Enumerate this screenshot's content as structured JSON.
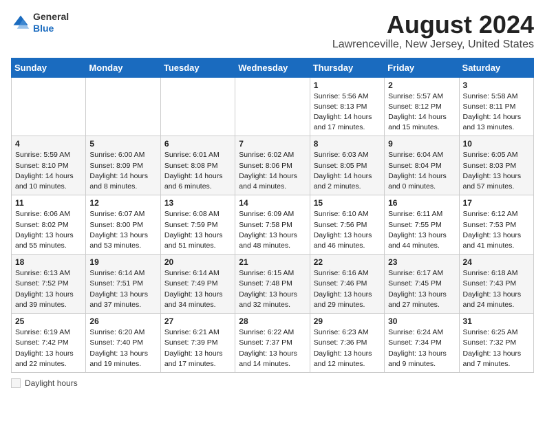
{
  "header": {
    "logo_general": "General",
    "logo_blue": "Blue",
    "main_title": "August 2024",
    "subtitle": "Lawrenceville, New Jersey, United States"
  },
  "weekdays": [
    "Sunday",
    "Monday",
    "Tuesday",
    "Wednesday",
    "Thursday",
    "Friday",
    "Saturday"
  ],
  "weeks": [
    [
      {
        "day": "",
        "info": ""
      },
      {
        "day": "",
        "info": ""
      },
      {
        "day": "",
        "info": ""
      },
      {
        "day": "",
        "info": ""
      },
      {
        "day": "1",
        "info": "Sunrise: 5:56 AM\nSunset: 8:13 PM\nDaylight: 14 hours and 17 minutes."
      },
      {
        "day": "2",
        "info": "Sunrise: 5:57 AM\nSunset: 8:12 PM\nDaylight: 14 hours and 15 minutes."
      },
      {
        "day": "3",
        "info": "Sunrise: 5:58 AM\nSunset: 8:11 PM\nDaylight: 14 hours and 13 minutes."
      }
    ],
    [
      {
        "day": "4",
        "info": "Sunrise: 5:59 AM\nSunset: 8:10 PM\nDaylight: 14 hours and 10 minutes."
      },
      {
        "day": "5",
        "info": "Sunrise: 6:00 AM\nSunset: 8:09 PM\nDaylight: 14 hours and 8 minutes."
      },
      {
        "day": "6",
        "info": "Sunrise: 6:01 AM\nSunset: 8:08 PM\nDaylight: 14 hours and 6 minutes."
      },
      {
        "day": "7",
        "info": "Sunrise: 6:02 AM\nSunset: 8:06 PM\nDaylight: 14 hours and 4 minutes."
      },
      {
        "day": "8",
        "info": "Sunrise: 6:03 AM\nSunset: 8:05 PM\nDaylight: 14 hours and 2 minutes."
      },
      {
        "day": "9",
        "info": "Sunrise: 6:04 AM\nSunset: 8:04 PM\nDaylight: 14 hours and 0 minutes."
      },
      {
        "day": "10",
        "info": "Sunrise: 6:05 AM\nSunset: 8:03 PM\nDaylight: 13 hours and 57 minutes."
      }
    ],
    [
      {
        "day": "11",
        "info": "Sunrise: 6:06 AM\nSunset: 8:02 PM\nDaylight: 13 hours and 55 minutes."
      },
      {
        "day": "12",
        "info": "Sunrise: 6:07 AM\nSunset: 8:00 PM\nDaylight: 13 hours and 53 minutes."
      },
      {
        "day": "13",
        "info": "Sunrise: 6:08 AM\nSunset: 7:59 PM\nDaylight: 13 hours and 51 minutes."
      },
      {
        "day": "14",
        "info": "Sunrise: 6:09 AM\nSunset: 7:58 PM\nDaylight: 13 hours and 48 minutes."
      },
      {
        "day": "15",
        "info": "Sunrise: 6:10 AM\nSunset: 7:56 PM\nDaylight: 13 hours and 46 minutes."
      },
      {
        "day": "16",
        "info": "Sunrise: 6:11 AM\nSunset: 7:55 PM\nDaylight: 13 hours and 44 minutes."
      },
      {
        "day": "17",
        "info": "Sunrise: 6:12 AM\nSunset: 7:53 PM\nDaylight: 13 hours and 41 minutes."
      }
    ],
    [
      {
        "day": "18",
        "info": "Sunrise: 6:13 AM\nSunset: 7:52 PM\nDaylight: 13 hours and 39 minutes."
      },
      {
        "day": "19",
        "info": "Sunrise: 6:14 AM\nSunset: 7:51 PM\nDaylight: 13 hours and 37 minutes."
      },
      {
        "day": "20",
        "info": "Sunrise: 6:14 AM\nSunset: 7:49 PM\nDaylight: 13 hours and 34 minutes."
      },
      {
        "day": "21",
        "info": "Sunrise: 6:15 AM\nSunset: 7:48 PM\nDaylight: 13 hours and 32 minutes."
      },
      {
        "day": "22",
        "info": "Sunrise: 6:16 AM\nSunset: 7:46 PM\nDaylight: 13 hours and 29 minutes."
      },
      {
        "day": "23",
        "info": "Sunrise: 6:17 AM\nSunset: 7:45 PM\nDaylight: 13 hours and 27 minutes."
      },
      {
        "day": "24",
        "info": "Sunrise: 6:18 AM\nSunset: 7:43 PM\nDaylight: 13 hours and 24 minutes."
      }
    ],
    [
      {
        "day": "25",
        "info": "Sunrise: 6:19 AM\nSunset: 7:42 PM\nDaylight: 13 hours and 22 minutes."
      },
      {
        "day": "26",
        "info": "Sunrise: 6:20 AM\nSunset: 7:40 PM\nDaylight: 13 hours and 19 minutes."
      },
      {
        "day": "27",
        "info": "Sunrise: 6:21 AM\nSunset: 7:39 PM\nDaylight: 13 hours and 17 minutes."
      },
      {
        "day": "28",
        "info": "Sunrise: 6:22 AM\nSunset: 7:37 PM\nDaylight: 13 hours and 14 minutes."
      },
      {
        "day": "29",
        "info": "Sunrise: 6:23 AM\nSunset: 7:36 PM\nDaylight: 13 hours and 12 minutes."
      },
      {
        "day": "30",
        "info": "Sunrise: 6:24 AM\nSunset: 7:34 PM\nDaylight: 13 hours and 9 minutes."
      },
      {
        "day": "31",
        "info": "Sunrise: 6:25 AM\nSunset: 7:32 PM\nDaylight: 13 hours and 7 minutes."
      }
    ]
  ],
  "footer": {
    "daylight_label": "Daylight hours"
  }
}
